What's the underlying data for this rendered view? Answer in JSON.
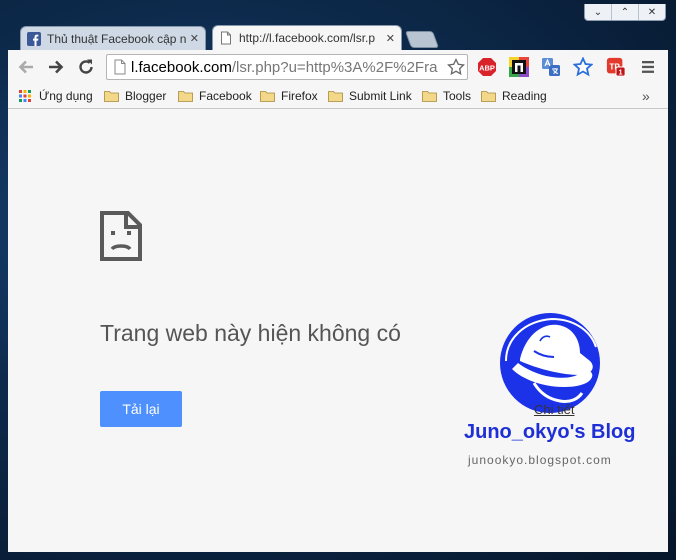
{
  "window_controls": [
    "⌄",
    "⌃",
    "✕"
  ],
  "tabs": [
    {
      "title": "Thủ thuật Facebook cập nh",
      "icon": "facebook-icon",
      "active": false
    },
    {
      "title": "http://l.facebook.com/lsr.p",
      "icon": "page-icon",
      "active": true
    }
  ],
  "omnibox": {
    "domain": "l.facebook.com",
    "rest": "/lsr.php?u=http%3A%2F%2Fra"
  },
  "extensions": [
    "ABP",
    "TP"
  ],
  "extension_badge": "1",
  "bookmarks": [
    {
      "label": "Ứng dụng",
      "icon": "apps-grid-icon"
    },
    {
      "label": "Blogger",
      "icon": "folder-icon"
    },
    {
      "label": "Facebook",
      "icon": "folder-icon"
    },
    {
      "label": "Firefox",
      "icon": "folder-icon"
    },
    {
      "label": "Submit Link",
      "icon": "folder-icon"
    },
    {
      "label": "Tools",
      "icon": "folder-icon"
    },
    {
      "label": "Reading",
      "icon": "folder-icon"
    }
  ],
  "bookmarks_overflow": "»",
  "error": {
    "title": "Trang web này hiện không có",
    "reload_label": "Tải lại",
    "details_label": "Chi tiết"
  },
  "watermark": {
    "title": "Juno_okyo's Blog",
    "url": "junookyo.blogspot.com"
  },
  "colors": {
    "accent": "#4d90fe",
    "brand_blue": "#1f2fd6",
    "facebook": "#3b5998"
  }
}
